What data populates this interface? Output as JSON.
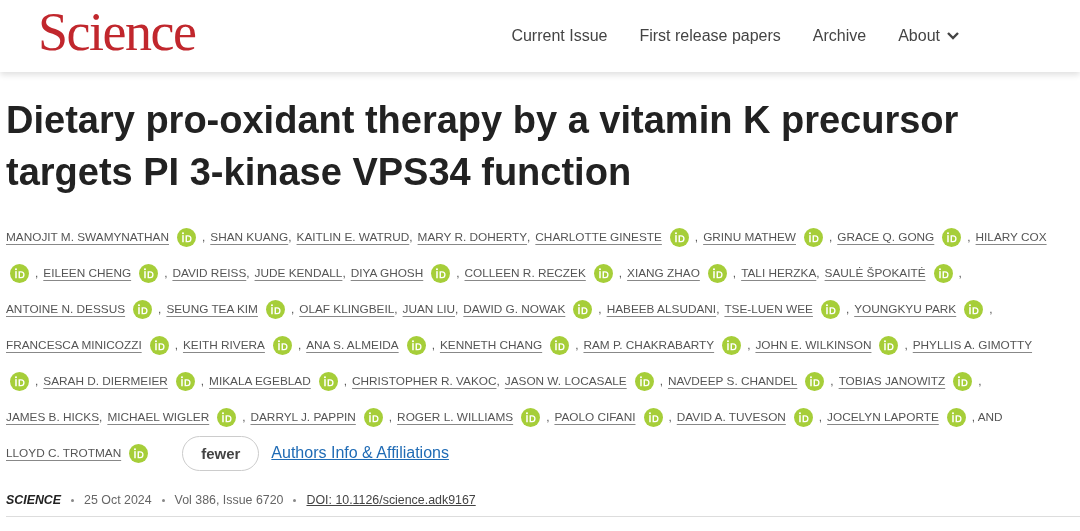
{
  "header": {
    "logo": "Science",
    "nav": [
      {
        "label": "Current Issue",
        "dropdown": false
      },
      {
        "label": "First release papers",
        "dropdown": false
      },
      {
        "label": "Archive",
        "dropdown": false
      },
      {
        "label": "About",
        "dropdown": true
      }
    ]
  },
  "title": "Dietary pro-oxidant therapy by a vitamin K precursor targets PI 3-kinase VPS34 function",
  "author_rows": [
    [
      {
        "name": "MANOJIT M. SWAMYNATHAN",
        "orcid": true,
        "sep": ","
      },
      {
        "name": "SHAN KUANG",
        "orcid": false,
        "sep": ","
      },
      {
        "name": "KAITLIN E. WATRUD",
        "orcid": false,
        "sep": ","
      },
      {
        "name": "MARY R. DOHERTY",
        "orcid": false,
        "sep": ","
      },
      {
        "name": "CHARLOTTE GINESTE",
        "orcid": true,
        "sep": ","
      },
      {
        "name": "GRINU MATHEW",
        "orcid": true,
        "sep": ","
      },
      {
        "name": "GRACE Q. GONG",
        "orcid": true,
        "sep": ","
      },
      {
        "name": "HILARY COX",
        "orcid": false
      }
    ],
    [
      {
        "orcid": true,
        "sep": ","
      },
      {
        "name": "EILEEN CHENG",
        "orcid": true,
        "sep": ","
      },
      {
        "name": "DAVID REISS",
        "orcid": false,
        "sep": ","
      },
      {
        "name": "JUDE KENDALL",
        "orcid": false,
        "sep": ","
      },
      {
        "name": "DIYA GHOSH",
        "orcid": true,
        "sep": ","
      },
      {
        "name": "COLLEEN R. RECZEK",
        "orcid": true,
        "sep": ","
      },
      {
        "name": "XIANG ZHAO",
        "orcid": true,
        "sep": ","
      },
      {
        "name": "TALI HERZKA",
        "orcid": false,
        "sep": ","
      },
      {
        "name": "SAULĖ ŠPOKAITĖ",
        "orcid": true,
        "sep": ","
      }
    ],
    [
      {
        "name": "ANTOINE N. DESSUS",
        "orcid": true,
        "sep": ","
      },
      {
        "name": "SEUNG TEA KIM",
        "orcid": true,
        "sep": ","
      },
      {
        "name": "OLAF KLINGBEIL",
        "orcid": false,
        "sep": ","
      },
      {
        "name": "JUAN LIU",
        "orcid": false,
        "sep": ","
      },
      {
        "name": "DAWID G. NOWAK",
        "orcid": true,
        "sep": ","
      },
      {
        "name": "HABEEB ALSUDANI",
        "orcid": false,
        "sep": ","
      },
      {
        "name": "TSE-LUEN WEE",
        "orcid": true,
        "sep": ","
      },
      {
        "name": "YOUNGKYU PARK",
        "orcid": true,
        "sep": ","
      }
    ],
    [
      {
        "name": "FRANCESCA MINICOZZI",
        "orcid": true,
        "sep": ","
      },
      {
        "name": "KEITH RIVERA",
        "orcid": true,
        "sep": ","
      },
      {
        "name": "ANA S. ALMEIDA",
        "orcid": true,
        "sep": ","
      },
      {
        "name": "KENNETH CHANG",
        "orcid": true,
        "sep": ","
      },
      {
        "name": "RAM P. CHAKRABARTY",
        "orcid": true,
        "sep": ","
      },
      {
        "name": "JOHN E. WILKINSON",
        "orcid": true,
        "sep": ","
      },
      {
        "name": "PHYLLIS A. GIMOTTY",
        "orcid": false
      }
    ],
    [
      {
        "orcid": true,
        "sep": ","
      },
      {
        "name": "SARAH D. DIERMEIER",
        "orcid": true,
        "sep": ","
      },
      {
        "name": "MIKALA EGEBLAD",
        "orcid": true,
        "sep": ","
      },
      {
        "name": "CHRISTOPHER R. VAKOC",
        "orcid": false,
        "sep": ","
      },
      {
        "name": "JASON W. LOCASALE",
        "orcid": true,
        "sep": ","
      },
      {
        "name": "NAVDEEP S. CHANDEL",
        "orcid": true,
        "sep": ","
      },
      {
        "name": "TOBIAS JANOWITZ",
        "orcid": true,
        "sep": ","
      }
    ],
    [
      {
        "name": "JAMES B. HICKS",
        "orcid": false,
        "sep": ","
      },
      {
        "name": "MICHAEL WIGLER",
        "orcid": true,
        "sep": ","
      },
      {
        "name": "DARRYL J. PAPPIN",
        "orcid": true,
        "sep": ","
      },
      {
        "name": "ROGER L. WILLIAMS",
        "orcid": true,
        "sep": ","
      },
      {
        "name": "PAOLO CIFANI",
        "orcid": true,
        "sep": ","
      },
      {
        "name": "DAVID A. TUVESON",
        "orcid": true,
        "sep": ","
      },
      {
        "name": "JOCELYN LAPORTE",
        "orcid": true,
        "sep": ", AND"
      }
    ],
    [
      {
        "name": "LLOYD C. TROTMAN",
        "orcid": true
      }
    ]
  ],
  "fewer_button": "fewer",
  "affiliations_link": "Authors Info & Affiliations",
  "meta": {
    "journal": "SCIENCE",
    "date": "25 Oct 2024",
    "volume": "Vol 386, Issue 6720",
    "doi": "DOI: 10.1126/science.adk9167"
  }
}
